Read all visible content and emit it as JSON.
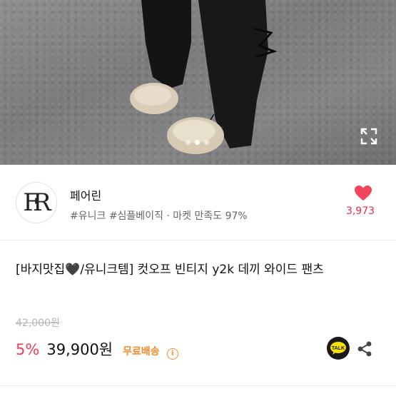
{
  "gallery": {
    "image_alt": "product photo",
    "dot_count": 3,
    "active_dot": 1,
    "expand_icon": "expand-icon"
  },
  "seller": {
    "avatar_text": "FR",
    "name": "페어린",
    "tags": "#유니크 #심플베이직 · 마켓 만족도 97%",
    "likes": "3,973",
    "heart_color": "#f0455b"
  },
  "product": {
    "title": "[바지맛집🖤/유니크템] 컷오프 빈티지 y2k 데끼 와이드 팬츠",
    "original_price": "42,000원",
    "discount": "5%",
    "price": "39,900원",
    "shipping": "무료배송",
    "shipping_color": "#f6892d",
    "info_icon": "i"
  },
  "actions": {
    "talk_label": "TALK",
    "share_icon": "share-icon"
  },
  "colors": {
    "discount": "#f03e5a",
    "likes": "#e8304f",
    "talk_bg": "#1a1a1a",
    "talk_badge": "#fae100"
  }
}
